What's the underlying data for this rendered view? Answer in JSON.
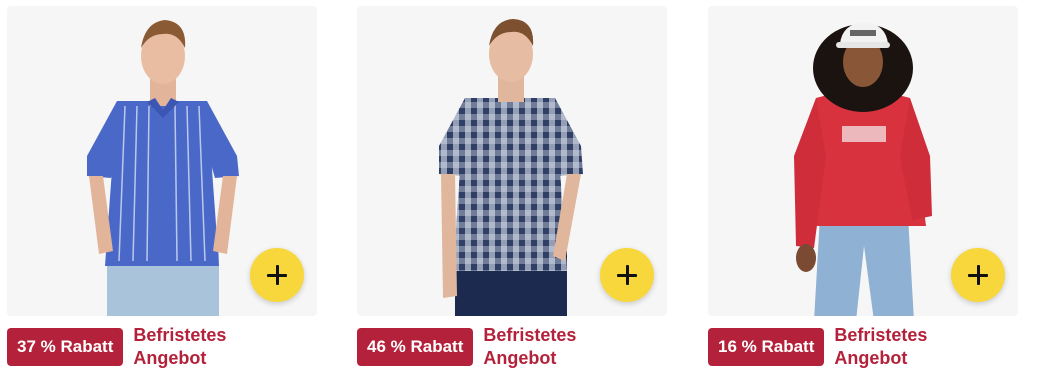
{
  "products": [
    {
      "image_alt": "Man in blue striped short-sleeve shirt",
      "discount": "37 % Rabatt",
      "offer_line1": "Befristetes",
      "offer_line2": "Angebot",
      "shirt_color": "#4a68c8",
      "pants_color": "#a9c3db"
    },
    {
      "image_alt": "Man in navy checked short-sleeve shirt",
      "discount": "46 % Rabatt",
      "offer_line1": "Befristetes",
      "offer_line2": "Angebot",
      "shirt_color": "#2f3f66",
      "pants_color": "#1d2a4f"
    },
    {
      "image_alt": "Woman in red hoodie and white cap",
      "discount": "16 % Rabatt",
      "offer_line1": "Befristetes",
      "offer_line2": "Angebot",
      "shirt_color": "#d8323f",
      "pants_color": "#8fb1d3"
    }
  ],
  "add_icon": "plus-icon",
  "colors": {
    "badge": "#b4213a",
    "add_button": "#f7d73b",
    "image_bg": "#f6f6f6"
  }
}
